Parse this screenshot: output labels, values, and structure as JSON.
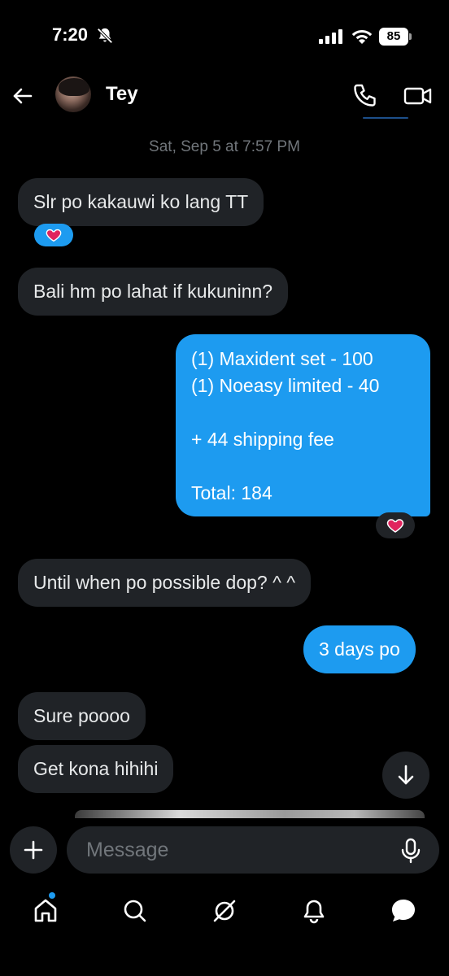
{
  "status_bar": {
    "time": "7:20",
    "battery": "85"
  },
  "header": {
    "contact_name": "Tey"
  },
  "conversation": {
    "timestamp": "Sat, Sep 5 at 7:57 PM",
    "messages": [
      {
        "direction": "incoming",
        "text": "Slr po kakauwi ko lang TT",
        "reaction": "❤️"
      },
      {
        "direction": "incoming",
        "text": "Bali hm po lahat if kukuninn?"
      },
      {
        "direction": "outgoing",
        "text": "(1) Maxident set - 100\n(1) Noeasy limited - 40\n\n+ 44 shipping fee\n\nTotal: 184",
        "reaction": "❤️"
      },
      {
        "direction": "incoming",
        "text": "Until when po possible dop? ^ ^"
      },
      {
        "direction": "outgoing",
        "text": "3 days po"
      },
      {
        "direction": "incoming",
        "text": "Sure poooo"
      },
      {
        "direction": "incoming",
        "text": "Get kona hihihi"
      }
    ]
  },
  "composer": {
    "placeholder": "Message"
  },
  "colors": {
    "accent": "#1d9bf0",
    "incoming_bubble": "#202327",
    "background": "#000000"
  },
  "icons": {
    "back": "arrow-left-icon",
    "call": "phone-icon",
    "video": "video-camera-icon",
    "scroll": "arrow-down-icon",
    "add": "plus-icon",
    "mic": "microphone-icon",
    "nav": [
      "home-icon",
      "search-icon",
      "grok-icon",
      "bell-icon",
      "messages-icon"
    ]
  }
}
